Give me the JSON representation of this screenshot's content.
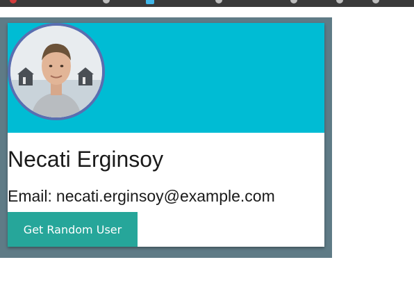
{
  "profile": {
    "name": "Necati Erginsoy",
    "email_label": "Email:",
    "email": "necati.erginsoy@example.com",
    "button_label": "Get Random User"
  },
  "colors": {
    "banner": "#00bcd4",
    "frame": "#5f7b86",
    "avatar_border": "#5a6eb0",
    "button": "#26a69a"
  }
}
